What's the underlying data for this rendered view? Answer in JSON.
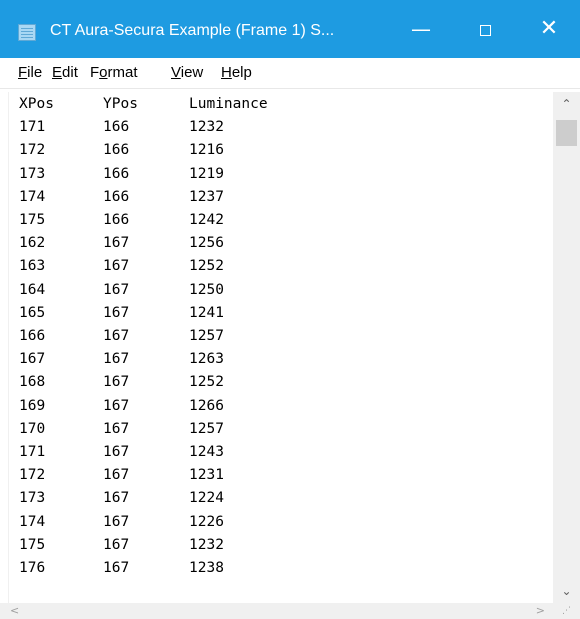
{
  "window": {
    "title": "CT Aura-Secura Example (Frame 1) S...",
    "minimize_glyph": "—",
    "close_glyph": "✕"
  },
  "menu": {
    "file": {
      "mn": "F",
      "rest": "ile"
    },
    "edit": {
      "mn": "E",
      "rest": "dit"
    },
    "format": {
      "pre": "F",
      "mn": "o",
      "rest": "rmat"
    },
    "view": {
      "mn": "V",
      "rest": "iew"
    },
    "help": {
      "mn": "H",
      "rest": "elp"
    }
  },
  "text": {
    "headers": [
      "XPos",
      "YPos",
      "Luminance"
    ],
    "rows": [
      [
        "171",
        "166",
        "1232"
      ],
      [
        "172",
        "166",
        "1216"
      ],
      [
        "173",
        "166",
        "1219"
      ],
      [
        "174",
        "166",
        "1237"
      ],
      [
        "175",
        "166",
        "1242"
      ],
      [
        "162",
        "167",
        "1256"
      ],
      [
        "163",
        "167",
        "1252"
      ],
      [
        "164",
        "167",
        "1250"
      ],
      [
        "165",
        "167",
        "1241"
      ],
      [
        "166",
        "167",
        "1257"
      ],
      [
        "167",
        "167",
        "1263"
      ],
      [
        "168",
        "167",
        "1252"
      ],
      [
        "169",
        "167",
        "1266"
      ],
      [
        "170",
        "167",
        "1257"
      ],
      [
        "171",
        "167",
        "1243"
      ],
      [
        "172",
        "167",
        "1231"
      ],
      [
        "173",
        "167",
        "1224"
      ],
      [
        "174",
        "167",
        "1226"
      ],
      [
        "175",
        "167",
        "1232"
      ],
      [
        "176",
        "167",
        "1238"
      ]
    ]
  },
  "scrollbar": {
    "up": "⌃",
    "down": "⌄",
    "left": "<",
    "right": ">",
    "grip": "⋰"
  },
  "colors": {
    "titlebar": "#1e9be1",
    "scrollbar_track": "#f0f0f0",
    "scrollbar_thumb": "#cdcdcd"
  },
  "icons": {
    "app": "notepad-icon",
    "minimize": "minimize-icon",
    "maximize": "maximize-icon",
    "close": "close-icon"
  }
}
